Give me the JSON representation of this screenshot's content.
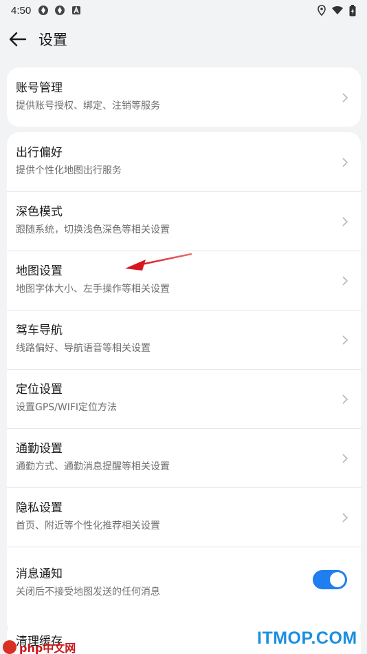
{
  "status": {
    "time": "4:50",
    "left_icons": [
      "app-icon",
      "app-icon",
      "font-icon"
    ],
    "right_icons": [
      "location-icon",
      "wifi-icon",
      "battery-icon"
    ]
  },
  "header": {
    "back_icon": "back-arrow-icon",
    "title": "设置"
  },
  "account": {
    "title": "账号管理",
    "subtitle": "提供账号授权、绑定、注销等服务"
  },
  "settings": [
    {
      "title": "出行偏好",
      "subtitle": "提供个性化地图出行服务"
    },
    {
      "title": "深色模式",
      "subtitle": "跟随系统，切换浅色深色等相关设置"
    },
    {
      "title": "地图设置",
      "subtitle": "地图字体大小、左手操作等相关设置"
    },
    {
      "title": "驾车导航",
      "subtitle": "线路偏好、导航语音等相关设置"
    },
    {
      "title": "定位设置",
      "subtitle": "设置GPS/WIFI定位方法"
    },
    {
      "title": "通勤设置",
      "subtitle": "通勤方式、通勤消息提醒等相关设置"
    },
    {
      "title": "隐私设置",
      "subtitle": "首页、附近等个性化推荐相关设置"
    }
  ],
  "notification": {
    "title": "消息通知",
    "subtitle": "关闭后不接受地图发送的任何消息",
    "enabled": true
  },
  "cache": {
    "title": "清理缓存"
  },
  "watermarks": {
    "left": "php中文网",
    "right": "ITMOP.COM"
  },
  "colors": {
    "accent": "#1f7ff0",
    "annotation_arrow": "#d8161b",
    "background": "#f1f3f5"
  }
}
